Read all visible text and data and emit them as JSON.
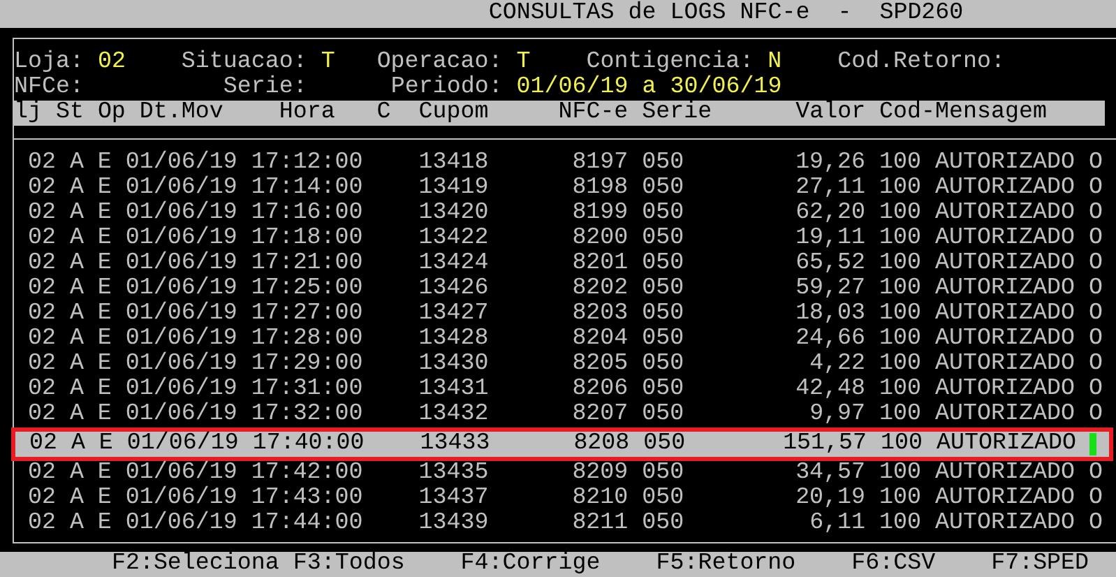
{
  "window": {
    "title": "CONSULTAS de LOGS NFC-e  -  SPD260"
  },
  "filters": [
    [
      {
        "label": "Loja:",
        "value": "02"
      },
      {
        "label": "Situacao:",
        "value": "T"
      },
      {
        "label": "Operacao:",
        "value": "T"
      },
      {
        "label": "Contigencia:",
        "value": "N"
      },
      {
        "label": "Cod.Retorno:"
      }
    ],
    [
      {
        "label": "NFCe:"
      },
      {
        "label": "Serie:"
      },
      {
        "label": "Periodo:",
        "value": "01/06/19 a 30/06/19"
      }
    ]
  ],
  "table": {
    "columns": [
      "lj",
      "St",
      "Op",
      "Dt.Mov",
      "Hora",
      "C",
      "Cupom",
      "NFC-e",
      "Serie",
      "Valor",
      "Cod-Mensagem"
    ],
    "rows": [
      {
        "lj": "02",
        "st": "A",
        "op": "E",
        "dt": "01/06/19",
        "hora": "17:12:00",
        "cupom": "13418",
        "nfce": "8197",
        "serie": "050",
        "valor": "19,26",
        "cod": "100",
        "msg": "AUTORIZADO",
        "tail": "O",
        "selected": false
      },
      {
        "lj": "02",
        "st": "A",
        "op": "E",
        "dt": "01/06/19",
        "hora": "17:14:00",
        "cupom": "13419",
        "nfce": "8198",
        "serie": "050",
        "valor": "27,11",
        "cod": "100",
        "msg": "AUTORIZADO",
        "tail": "O",
        "selected": false
      },
      {
        "lj": "02",
        "st": "A",
        "op": "E",
        "dt": "01/06/19",
        "hora": "17:16:00",
        "cupom": "13420",
        "nfce": "8199",
        "serie": "050",
        "valor": "62,20",
        "cod": "100",
        "msg": "AUTORIZADO",
        "tail": "O",
        "selected": false
      },
      {
        "lj": "02",
        "st": "A",
        "op": "E",
        "dt": "01/06/19",
        "hora": "17:18:00",
        "cupom": "13422",
        "nfce": "8200",
        "serie": "050",
        "valor": "19,11",
        "cod": "100",
        "msg": "AUTORIZADO",
        "tail": "O",
        "selected": false
      },
      {
        "lj": "02",
        "st": "A",
        "op": "E",
        "dt": "01/06/19",
        "hora": "17:21:00",
        "cupom": "13424",
        "nfce": "8201",
        "serie": "050",
        "valor": "65,52",
        "cod": "100",
        "msg": "AUTORIZADO",
        "tail": "O",
        "selected": false
      },
      {
        "lj": "02",
        "st": "A",
        "op": "E",
        "dt": "01/06/19",
        "hora": "17:25:00",
        "cupom": "13426",
        "nfce": "8202",
        "serie": "050",
        "valor": "59,27",
        "cod": "100",
        "msg": "AUTORIZADO",
        "tail": "O",
        "selected": false
      },
      {
        "lj": "02",
        "st": "A",
        "op": "E",
        "dt": "01/06/19",
        "hora": "17:27:00",
        "cupom": "13427",
        "nfce": "8203",
        "serie": "050",
        "valor": "18,03",
        "cod": "100",
        "msg": "AUTORIZADO",
        "tail": "O",
        "selected": false
      },
      {
        "lj": "02",
        "st": "A",
        "op": "E",
        "dt": "01/06/19",
        "hora": "17:28:00",
        "cupom": "13428",
        "nfce": "8204",
        "serie": "050",
        "valor": "24,66",
        "cod": "100",
        "msg": "AUTORIZADO",
        "tail": "O",
        "selected": false
      },
      {
        "lj": "02",
        "st": "A",
        "op": "E",
        "dt": "01/06/19",
        "hora": "17:29:00",
        "cupom": "13430",
        "nfce": "8205",
        "serie": "050",
        "valor": "4,22",
        "cod": "100",
        "msg": "AUTORIZADO",
        "tail": "O",
        "selected": false
      },
      {
        "lj": "02",
        "st": "A",
        "op": "E",
        "dt": "01/06/19",
        "hora": "17:31:00",
        "cupom": "13431",
        "nfce": "8206",
        "serie": "050",
        "valor": "42,48",
        "cod": "100",
        "msg": "AUTORIZADO",
        "tail": "O",
        "selected": false
      },
      {
        "lj": "02",
        "st": "A",
        "op": "E",
        "dt": "01/06/19",
        "hora": "17:32:00",
        "cupom": "13432",
        "nfce": "8207",
        "serie": "050",
        "valor": "9,97",
        "cod": "100",
        "msg": "AUTORIZADO",
        "tail": "O",
        "selected": false
      },
      {
        "lj": "02",
        "st": "A",
        "op": "E",
        "dt": "01/06/19",
        "hora": "17:40:00",
        "cupom": "13433",
        "nfce": "8208",
        "serie": "050",
        "valor": "151,57",
        "cod": "100",
        "msg": "AUTORIZADO",
        "selected": true
      },
      {
        "lj": "02",
        "st": "A",
        "op": "E",
        "dt": "01/06/19",
        "hora": "17:42:00",
        "cupom": "13435",
        "nfce": "8209",
        "serie": "050",
        "valor": "34,57",
        "cod": "100",
        "msg": "AUTORIZADO",
        "tail": "O",
        "selected": false
      },
      {
        "lj": "02",
        "st": "A",
        "op": "E",
        "dt": "01/06/19",
        "hora": "17:43:00",
        "cupom": "13437",
        "nfce": "8210",
        "serie": "050",
        "valor": "20,19",
        "cod": "100",
        "msg": "AUTORIZADO",
        "tail": "O",
        "selected": false
      },
      {
        "lj": "02",
        "st": "A",
        "op": "E",
        "dt": "01/06/19",
        "hora": "17:44:00",
        "cupom": "13439",
        "nfce": "8211",
        "serie": "050",
        "valor": "6,11",
        "cod": "100",
        "msg": "AUTORIZADO",
        "tail": "O",
        "selected": false
      }
    ]
  },
  "function_keys": [
    "F2:Seleciona",
    "F3:Todos",
    "F4:Corrige",
    "F5:Retorno",
    "F6:CSV",
    "F7:SPED"
  ]
}
